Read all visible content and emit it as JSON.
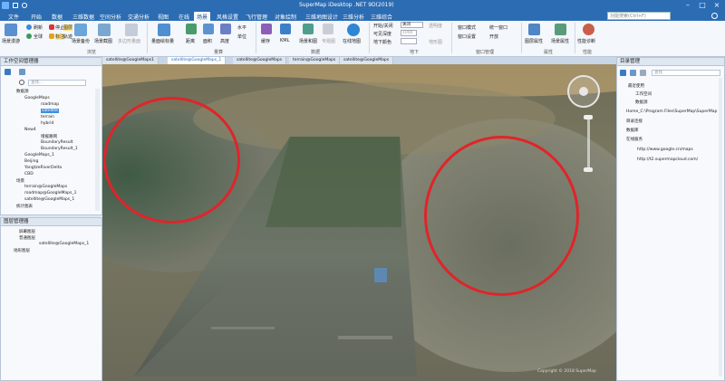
{
  "app": {
    "title": "SuperMap iDesktop .NET 9D(2019)"
  },
  "menu": [
    "文件",
    "开始",
    "数据",
    "三维数据",
    "空间分析",
    "交通分析",
    "视图",
    "在线",
    "场景",
    "风格设置",
    "飞行管理",
    "对象绘制",
    "三维地图设计",
    "三维分析",
    "三维综合"
  ],
  "menu_active_index": 8,
  "help_placeholder": "功能搜索(Ctrl+F)",
  "ribbon": {
    "buttons": [
      "场景漫游",
      "刷新",
      "全球",
      "停止",
      "标注",
      "图层",
      "轨迹",
      "场景备份",
      "场景截图",
      "多边形量面",
      "量面绘标量",
      "距离",
      "面积",
      "高度",
      "水平",
      "单位",
      "缓存",
      "KML",
      "场景和图",
      "专题图",
      "在线地图",
      "开始/关闭",
      "可见深度",
      "地下颜色",
      "透明度",
      "1000",
      "地形图",
      "窗口模式",
      "统一窗口",
      "窗口设置",
      "开放",
      "图层属性",
      "场景属性",
      "性能诊断"
    ],
    "groups": [
      "浏览",
      "量算",
      "数据",
      "地下",
      "窗口管理",
      "属性",
      "性能"
    ]
  },
  "workspace": {
    "title": "工作空间管理器",
    "search_placeholder": "查找...",
    "tree": [
      "数据源",
      "GoogleMaps",
      "roadmap",
      "satellite",
      "terrain",
      "hybrid",
      "New4",
      "增援路网",
      "BoundaryResult",
      "BoundaryResult_1",
      "GoogleMaps_1",
      "Beijing",
      "YangtzeRiverDelta",
      "CBD",
      "场景",
      "terrain@GoogleMaps",
      "roadmap@GoogleMaps_1",
      "satellite@GoogleMaps_1",
      "统计图表"
    ]
  },
  "layers": {
    "title": "图层管理器",
    "tree": [
      "屏幕图层",
      "普通图层",
      "satellite@GoogleMaps_1",
      "地形图层"
    ]
  },
  "tabs": [
    "satellite@GoogleMaps1",
    "satellite@GoogleMaps_1",
    "satellite@GoogleMaps",
    "terrain@GoogleMaps",
    "satellite@GoogleMaps"
  ],
  "tabs_active_index": 1,
  "scene": {
    "status": "Copyright © 2018 SuperMap"
  },
  "catalog": {
    "title": "目录管理",
    "search_placeholder": "查找",
    "tree": [
      "最近使用",
      "工作空间",
      "数据源",
      "Home_C:\\Program Files\\SuperMap\\SuperMap",
      "目录连接",
      "数据库",
      "在线服务",
      "http://www.google.cn/maps",
      "http://t2.supermapcloud.com/"
    ]
  },
  "colors": {
    "title_bar": "#2b6cb3",
    "annotation_circle": "#e0242a",
    "ribbon_bg": "#f4f7fb"
  }
}
